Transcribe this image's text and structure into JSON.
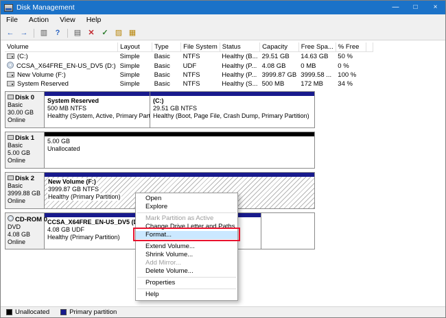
{
  "window": {
    "title": "Disk Management",
    "controls": {
      "minimize": "—",
      "maximize": "□",
      "close": "×"
    }
  },
  "menu": {
    "items": [
      "File",
      "Action",
      "View",
      "Help"
    ]
  },
  "toolbar": {
    "icons": [
      {
        "name": "back-arrow",
        "glyph": "←"
      },
      {
        "name": "forward-arrow",
        "glyph": "→"
      },
      {
        "name": "console-tree-icon",
        "glyph": "▥"
      },
      {
        "name": "help-icon",
        "glyph": "?"
      },
      {
        "name": "report-icon",
        "glyph": "▤"
      },
      {
        "name": "delete-icon",
        "glyph": "✕"
      },
      {
        "name": "check-icon",
        "glyph": "✓"
      },
      {
        "name": "folder-icon",
        "glyph": "▨"
      },
      {
        "name": "properties-icon",
        "glyph": "▦"
      }
    ]
  },
  "volumes": {
    "columns": [
      "Volume",
      "Layout",
      "Type",
      "File System",
      "Status",
      "Capacity",
      "Free Spa...",
      "% Free"
    ],
    "rows": [
      {
        "volume": "(C:)",
        "layout": "Simple",
        "type": "Basic",
        "fs": "NTFS",
        "status": "Healthy (B...",
        "capacity": "29.51 GB",
        "free": "14.63 GB",
        "pct": "50 %"
      },
      {
        "volume": "CCSA_X64FRE_EN-US_DV5 (D:)",
        "layout": "Simple",
        "type": "Basic",
        "fs": "UDF",
        "status": "Healthy (P...",
        "capacity": "4.08 GB",
        "free": "0 MB",
        "pct": "0 %"
      },
      {
        "volume": "New Volume (F:)",
        "layout": "Simple",
        "type": "Basic",
        "fs": "NTFS",
        "status": "Healthy (P...",
        "capacity": "3999.87 GB",
        "free": "3999.58 ...",
        "pct": "100 %"
      },
      {
        "volume": "System Reserved",
        "layout": "Simple",
        "type": "Basic",
        "fs": "NTFS",
        "status": "Healthy (S...",
        "capacity": "500 MB",
        "free": "172 MB",
        "pct": "34 %"
      }
    ]
  },
  "disks": [
    {
      "name": "Disk 0",
      "kind": "Basic",
      "size": "30.00 GB",
      "status": "Online",
      "partitions": [
        {
          "title": "System Reserved",
          "detail": "500 MB NTFS",
          "health": "Healthy (System, Active, Primary Partition)"
        },
        {
          "title": "(C:)",
          "detail": "29.51 GB NTFS",
          "health": "Healthy (Boot, Page File, Crash Dump, Primary Partition)"
        }
      ]
    },
    {
      "name": "Disk 1",
      "kind": "Basic",
      "size": "5.00 GB",
      "status": "Online",
      "partitions": [
        {
          "title": "",
          "detail": "5.00 GB",
          "health": "Unallocated"
        }
      ]
    },
    {
      "name": "Disk 2",
      "kind": "Basic",
      "size": "3999.88 GB",
      "status": "Online",
      "partitions": [
        {
          "title": "New Volume (F:)",
          "detail": "3999.87 GB NTFS",
          "health": "Healthy (Primary Partition)"
        }
      ]
    },
    {
      "name": "CD-ROM 0",
      "kind": "DVD",
      "size": "4.08 GB",
      "status": "Online",
      "partitions": [
        {
          "title": "CCSA_X64FRE_EN-US_DV5 (D:)",
          "detail": "4.08 GB UDF",
          "health": "Healthy (Primary Partition)"
        }
      ]
    }
  ],
  "context_menu": {
    "items": [
      {
        "label": "Open"
      },
      {
        "label": "Explore"
      },
      {
        "label": "Mark Partition as Active",
        "disabled": true
      },
      {
        "label": "Change Drive Letter and Paths..."
      },
      {
        "label": "Format...",
        "highlighted": true
      },
      {
        "label": "Extend Volume..."
      },
      {
        "label": "Shrink Volume..."
      },
      {
        "label": "Add Mirror...",
        "disabled": true
      },
      {
        "label": "Delete Volume..."
      },
      {
        "label": "Properties"
      },
      {
        "label": "Help"
      }
    ]
  },
  "legend": {
    "items": [
      {
        "label": "Unallocated",
        "color": "#000000"
      },
      {
        "label": "Primary partition",
        "color": "#181a8d"
      }
    ]
  },
  "colors": {
    "titlebar": "#1b72c8",
    "primary_partition": "#181a8d",
    "unallocated": "#000000",
    "menu_highlight": "#cbe8ff",
    "annotation_red": "#e8112d"
  }
}
